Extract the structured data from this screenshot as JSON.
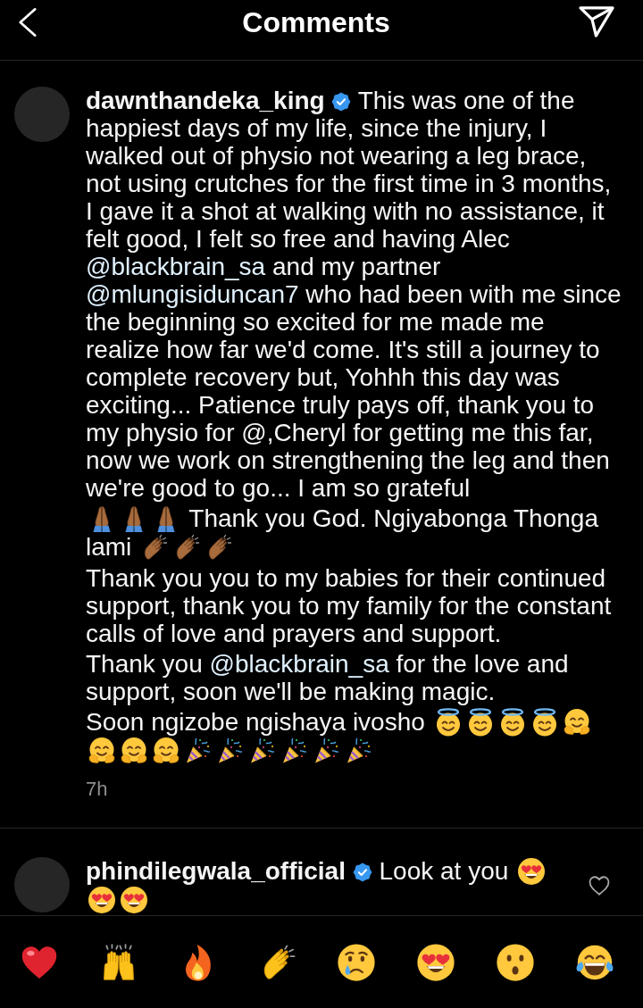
{
  "header": {
    "title": "Comments"
  },
  "comments": [
    {
      "username": "dawnthandeka_king",
      "verified": true,
      "body": [
        {
          "kind": "text",
          "runs": [
            {
              "kind": "plain",
              "text": "This was one of the happiest days of my life, since the injury, I walked out of physio not wearing a leg brace, not using crutches for the first time in 3 months, I gave it a shot at walking with no assistance, it felt good, I felt so free and having Alec"
            },
            {
              "kind": "mention",
              "text": "@blackbrain_sa"
            },
            {
              "kind": "plain",
              "text": "and my partner"
            },
            {
              "kind": "mention",
              "text": "@mlungisiduncan7"
            },
            {
              "kind": "plain",
              "text": "who had been with me since the beginning so excited for me made me realize how far we'd come. It's still a journey to complete recovery but, Yohhh this day was exciting... Patience truly pays off, thank you to my physio for @,Cheryl for getting me this far, now we work on strengthening the leg and then we're good to go... I am so grateful"
            }
          ]
        },
        {
          "kind": "break"
        },
        {
          "kind": "pray"
        },
        {
          "kind": "pray"
        },
        {
          "kind": "pray"
        },
        {
          "kind": "text",
          "runs": [
            {
              "kind": "plain",
              "text": "Thank you God. Ngiyabonga Thonga lami"
            }
          ]
        },
        {
          "kind": "clap"
        },
        {
          "kind": "clap"
        },
        {
          "kind": "clap"
        },
        {
          "kind": "break"
        },
        {
          "kind": "text",
          "runs": [
            {
              "kind": "plain",
              "text": "Thank you you to my babies for their continued support, thank you to my family for the constant calls of love and prayers and support."
            }
          ]
        },
        {
          "kind": "break"
        },
        {
          "kind": "text",
          "runs": [
            {
              "kind": "plain",
              "text": "Thank you"
            },
            {
              "kind": "mention",
              "text": "@blackbrain_sa"
            },
            {
              "kind": "plain",
              "text": "for the love and support, soon we'll be making magic."
            }
          ]
        },
        {
          "kind": "break"
        },
        {
          "kind": "text",
          "runs": [
            {
              "kind": "plain",
              "text": "Soon ngizobe ngishaya ivosho"
            }
          ]
        },
        {
          "kind": "halo"
        },
        {
          "kind": "halo"
        },
        {
          "kind": "halo"
        },
        {
          "kind": "halo"
        },
        {
          "kind": "hug"
        },
        {
          "kind": "hug"
        },
        {
          "kind": "hug"
        },
        {
          "kind": "hug"
        },
        {
          "kind": "party"
        },
        {
          "kind": "party"
        },
        {
          "kind": "party"
        },
        {
          "kind": "party"
        },
        {
          "kind": "party"
        },
        {
          "kind": "party"
        }
      ],
      "time": "7h"
    },
    {
      "username": "phindilegwala_official",
      "verified": true,
      "body": [
        {
          "kind": "text",
          "runs": [
            {
              "kind": "plain",
              "text": "Look at you"
            }
          ]
        },
        {
          "kind": "hearteyes"
        },
        {
          "kind": "hearteyes"
        },
        {
          "kind": "hearteyes"
        }
      ],
      "liked": false
    }
  ]
}
